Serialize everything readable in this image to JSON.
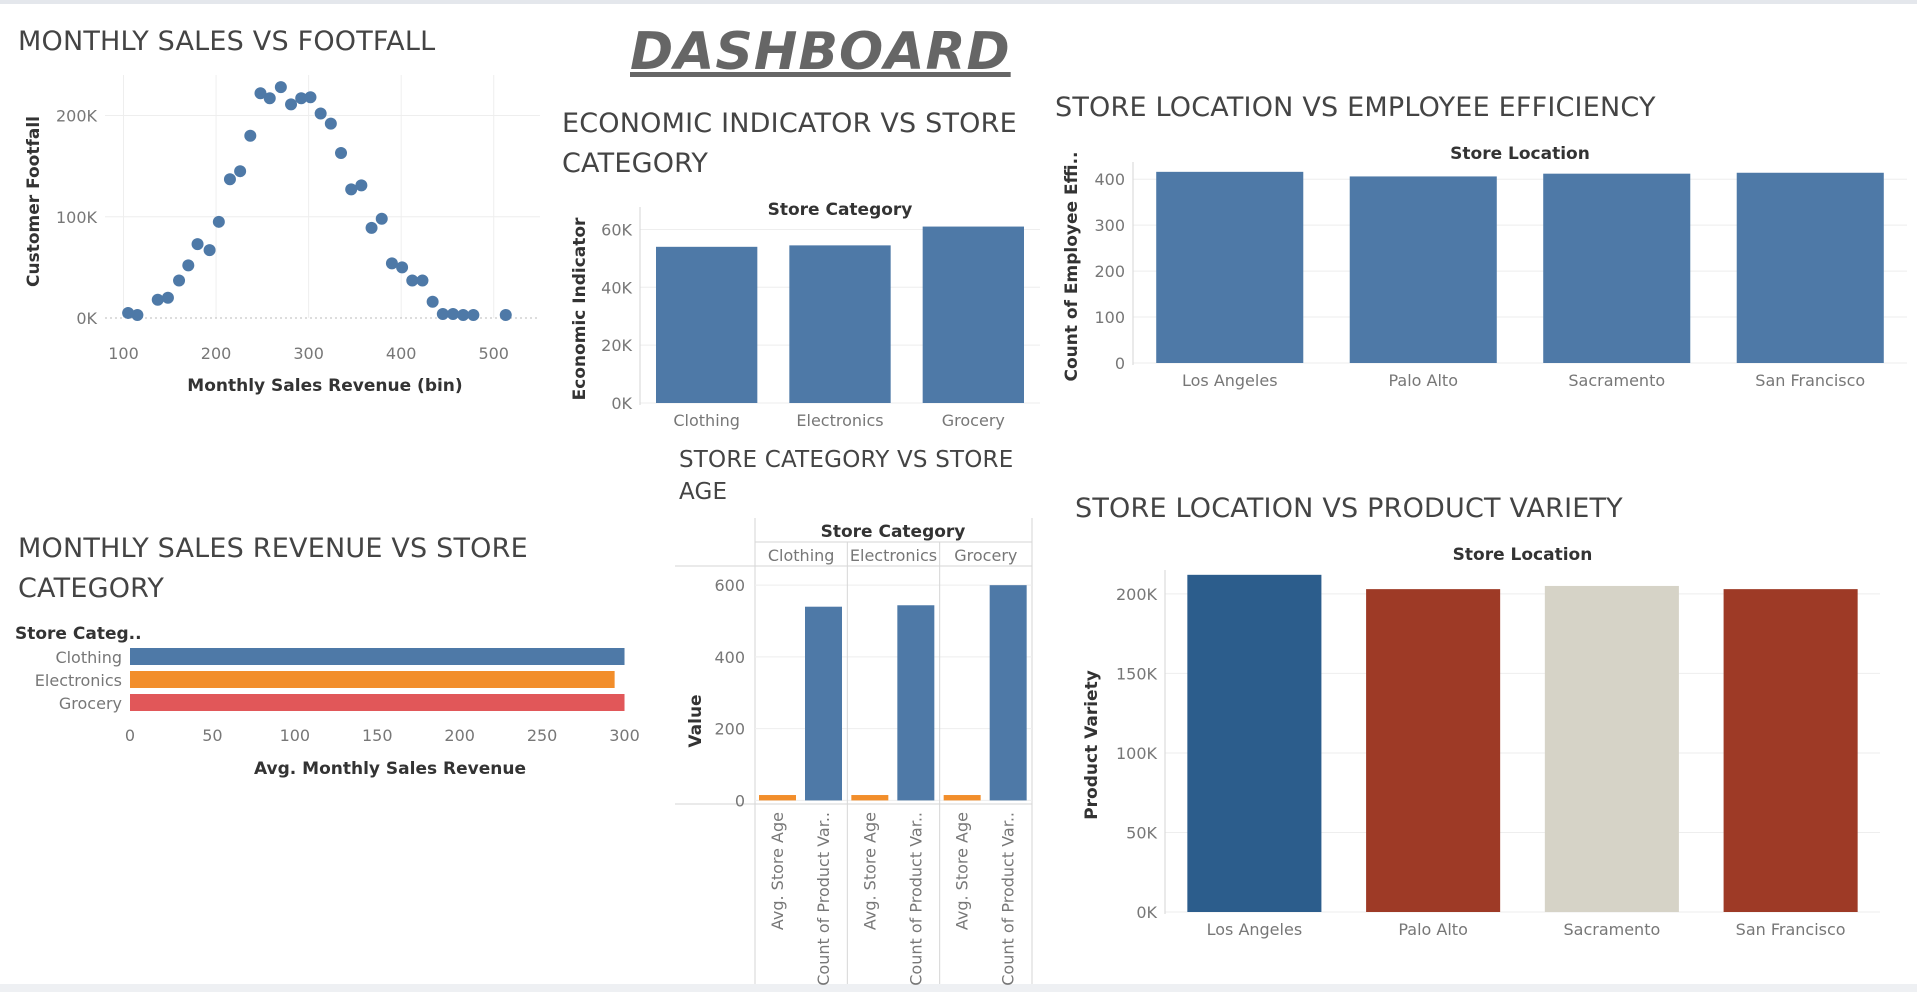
{
  "dashboard_title": "DASHBOARD",
  "chart_data": [
    {
      "id": "footfall",
      "type": "scatter",
      "title": "MONTHLY SALES VS FOOTFALL",
      "xlabel": "Monthly Sales Revenue (bin)",
      "ylabel": "Customer Footfall",
      "xlim": [
        80,
        550
      ],
      "ylim": [
        0,
        240000
      ],
      "xticks": [
        100,
        200,
        300,
        400,
        500
      ],
      "yticks": [
        0,
        100000,
        200000
      ],
      "ytick_labels": [
        "0K",
        "100K",
        "200K"
      ],
      "color": "#4e79a7",
      "points": [
        {
          "x": 105,
          "y": 5000
        },
        {
          "x": 115,
          "y": 3000
        },
        {
          "x": 137,
          "y": 18000
        },
        {
          "x": 148,
          "y": 20000
        },
        {
          "x": 160,
          "y": 37000
        },
        {
          "x": 170,
          "y": 52000
        },
        {
          "x": 180,
          "y": 73000
        },
        {
          "x": 193,
          "y": 67000
        },
        {
          "x": 203,
          "y": 95000
        },
        {
          "x": 215,
          "y": 137000
        },
        {
          "x": 226,
          "y": 145000
        },
        {
          "x": 237,
          "y": 180000
        },
        {
          "x": 248,
          "y": 222000
        },
        {
          "x": 258,
          "y": 217000
        },
        {
          "x": 270,
          "y": 228000
        },
        {
          "x": 281,
          "y": 211000
        },
        {
          "x": 292,
          "y": 217000
        },
        {
          "x": 302,
          "y": 218000
        },
        {
          "x": 313,
          "y": 202000
        },
        {
          "x": 324,
          "y": 192000
        },
        {
          "x": 335,
          "y": 163000
        },
        {
          "x": 346,
          "y": 127000
        },
        {
          "x": 357,
          "y": 131000
        },
        {
          "x": 368,
          "y": 89000
        },
        {
          "x": 379,
          "y": 98000
        },
        {
          "x": 390,
          "y": 54000
        },
        {
          "x": 401,
          "y": 50000
        },
        {
          "x": 412,
          "y": 37000
        },
        {
          "x": 423,
          "y": 37000
        },
        {
          "x": 434,
          "y": 16000
        },
        {
          "x": 445,
          "y": 4000
        },
        {
          "x": 456,
          "y": 4000
        },
        {
          "x": 467,
          "y": 3000
        },
        {
          "x": 478,
          "y": 3000
        },
        {
          "x": 513,
          "y": 3000
        }
      ]
    },
    {
      "id": "economic",
      "type": "bar",
      "title": "ECONOMIC INDICATOR VS STORE CATEGORY",
      "header": "Store Category",
      "ylabel": "Economic Indicator",
      "ylim": [
        0,
        65000
      ],
      "yticks": [
        0,
        20000,
        40000,
        60000
      ],
      "ytick_labels": [
        "0K",
        "20K",
        "40K",
        "60K"
      ],
      "categories": [
        "Clothing",
        "Electronics",
        "Grocery"
      ],
      "values": [
        54000,
        54500,
        61000
      ],
      "color": "#4e79a7"
    },
    {
      "id": "efficiency",
      "type": "bar",
      "title": "STORE LOCATION VS EMPLOYEE EFFICIENCY",
      "header": "Store Location",
      "ylabel": "Count of Employee Effi..",
      "ylim": [
        0,
        420
      ],
      "yticks": [
        0,
        100,
        200,
        300,
        400
      ],
      "ytick_labels": [
        "0",
        "100",
        "200",
        "300",
        "400"
      ],
      "categories": [
        "Los Angeles",
        "Palo Alto",
        "Sacramento",
        "San Francisco"
      ],
      "values": [
        416,
        406,
        412,
        414
      ],
      "color": "#4e79a7"
    },
    {
      "id": "revenue",
      "type": "bar",
      "orientation": "horizontal",
      "title": "MONTHLY SALES REVENUE VS STORE CATEGORY",
      "row_header": "Store Categ..",
      "xlabel": "Avg. Monthly Sales Revenue",
      "xlim": [
        0,
        310
      ],
      "xticks": [
        0,
        50,
        100,
        150,
        200,
        250,
        300
      ],
      "categories": [
        "Clothing",
        "Electronics",
        "Grocery"
      ],
      "values": [
        300,
        294,
        300
      ],
      "colors": [
        "#4e79a7",
        "#f28e2b",
        "#e15759"
      ]
    },
    {
      "id": "age",
      "type": "bar",
      "title": "STORE CATEGORY VS STORE AGE",
      "header": "Store Category",
      "ylabel": "Value",
      "ylim": [
        -10,
        620
      ],
      "yticks": [
        0,
        200,
        400,
        600
      ],
      "groups": [
        "Clothing",
        "Electronics",
        "Grocery"
      ],
      "measures": [
        "Avg. Store Age",
        "Count of Product Var.."
      ],
      "colors": [
        "#f28e2b",
        "#4e79a7"
      ],
      "series": [
        {
          "values": [
            15,
            15,
            15
          ]
        },
        {
          "values": [
            540,
            544,
            600
          ]
        }
      ]
    },
    {
      "id": "variety",
      "type": "bar",
      "title": "STORE LOCATION VS PRODUCT VARIETY",
      "header": "Store Location",
      "ylabel": "Product Variety",
      "ylim": [
        0,
        210000
      ],
      "yticks": [
        0,
        50000,
        100000,
        150000,
        200000
      ],
      "ytick_labels": [
        "0K",
        "50K",
        "100K",
        "150K",
        "200K"
      ],
      "categories": [
        "Los Angeles",
        "Palo Alto",
        "Sacramento",
        "San Francisco"
      ],
      "values": [
        212000,
        203000,
        205000,
        203000
      ],
      "colors": [
        "#2c5d8c",
        "#9e3a26",
        "#d6d3c7",
        "#9e3a26"
      ]
    }
  ]
}
